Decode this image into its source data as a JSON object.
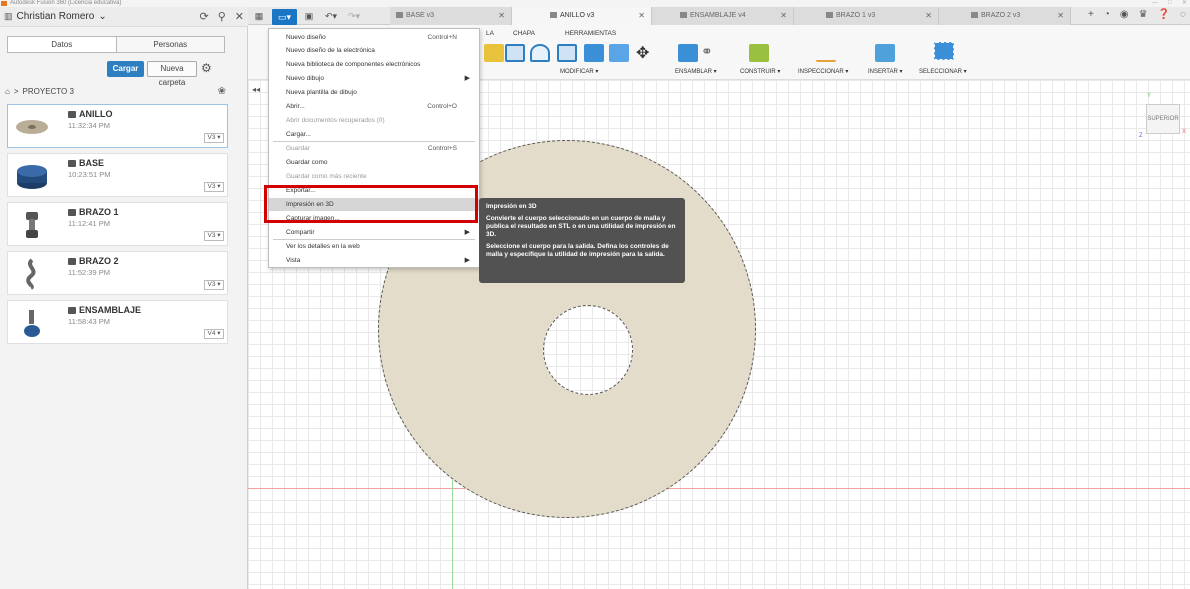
{
  "window": {
    "title": "Autodesk Fusion 360 (Licencia educativa)"
  },
  "left_panel": {
    "user": "Christian Romero",
    "tabs": [
      "Datos",
      "Personas"
    ],
    "upload_button": "Cargar",
    "new_folder_button": "Nueva carpeta",
    "breadcrumb": "PROYECTO 3",
    "files": [
      {
        "name": "ANILLO",
        "time": "11:32:34 PM",
        "version": "V3"
      },
      {
        "name": "BASE",
        "time": "10:23:51 PM",
        "version": "V3"
      },
      {
        "name": "BRAZO 1",
        "time": "11:12:41 PM",
        "version": "V3"
      },
      {
        "name": "BRAZO 2",
        "time": "11:52:39 PM",
        "version": "V3"
      },
      {
        "name": "ENSAMBLAJE",
        "time": "11:58:43 PM",
        "version": "V4"
      }
    ]
  },
  "doc_tabs": [
    "BASE v3",
    "ANILLO v3",
    "ENSAMBLAJE v4",
    "BRAZO 1 v3",
    "BRAZO 2 v3"
  ],
  "toolbar": {
    "tabs": [
      "LA",
      "CHAPA",
      "HERRAMIENTAS"
    ],
    "groups": [
      "MODIFICAR",
      "ENSAMBLAR",
      "CONSTRUIR",
      "INSPECCIONAR",
      "INSERTAR",
      "SELECCIONAR"
    ]
  },
  "file_menu": [
    {
      "label": "Nuevo diseño",
      "shortcut": "Control+N",
      "disabled": false
    },
    {
      "label": "Nuevo diseño de la electrónica",
      "disabled": false
    },
    {
      "label": "Nueva biblioteca de componentes electrónicos",
      "disabled": false
    },
    {
      "label": "Nuevo dibujo",
      "submenu": true,
      "disabled": false
    },
    {
      "label": "Nueva plantilla de dibujo",
      "disabled": false
    },
    {
      "label": "Abrir...",
      "shortcut": "Control+O",
      "disabled": false
    },
    {
      "label": "Abrir documentos recuperados (0)",
      "disabled": true
    },
    {
      "label": "Cargar...",
      "disabled": false
    },
    {
      "label": "Guardar",
      "shortcut": "Control+S",
      "disabled": true
    },
    {
      "label": "Guardar como",
      "disabled": false
    },
    {
      "label": "Guardar como más reciente",
      "disabled": true
    },
    {
      "label": "Exportar...",
      "disabled": false
    },
    {
      "label": "Impresión en 3D",
      "disabled": false,
      "highlighted": true
    },
    {
      "label": "Capturar imagen...",
      "disabled": false
    },
    {
      "label": "Compartir",
      "submenu": true,
      "disabled": false
    },
    {
      "label": "Ver los detalles en la web",
      "disabled": false
    },
    {
      "label": "Vista",
      "submenu": true,
      "disabled": false
    }
  ],
  "tooltip": {
    "title": "Impresión en 3D",
    "p1": "Convierte el cuerpo seleccionado en un cuerpo de malla y publica el resultado en STL o en una utilidad de impresión en 3D.",
    "p2": "Seleccione el cuerpo para la salida. Defina los controles de malla y especifique la utilidad de impresión para la salida."
  },
  "viewcube": {
    "face": "SUPERIOR",
    "axis_y": "Y",
    "axis_x": "X",
    "axis_z": "Z"
  },
  "colors": {
    "accent": "#2e7fc1",
    "highlight_box": "#d20000",
    "part": "#e4dcca"
  }
}
